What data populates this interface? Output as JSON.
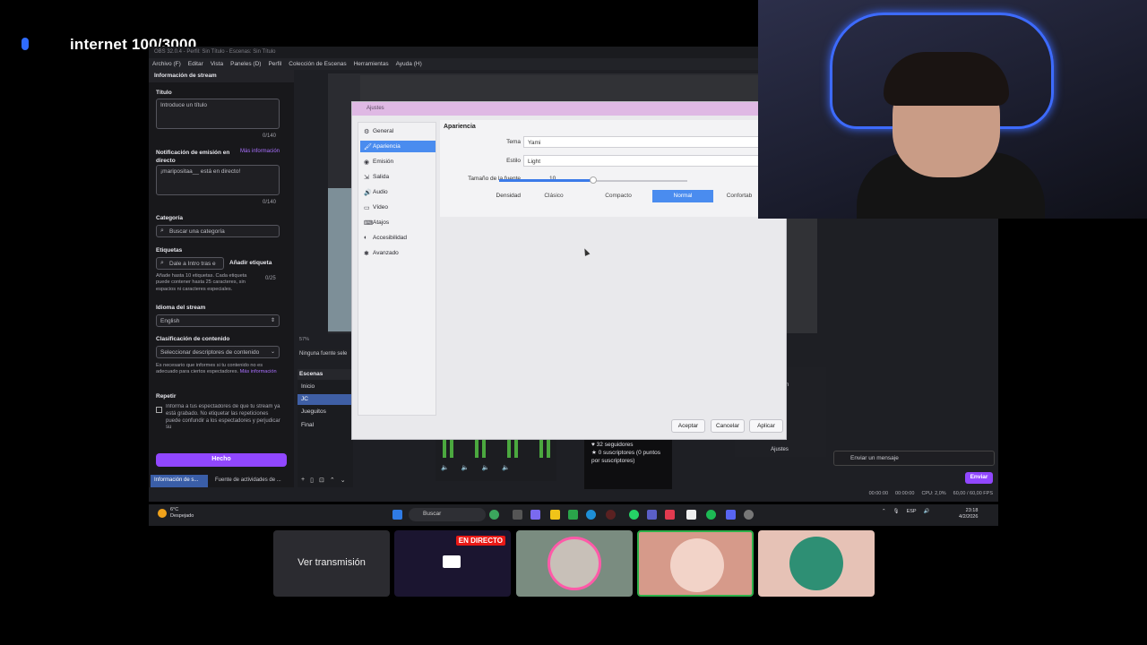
{
  "overlay": {
    "internet_text": "internet 100/3000"
  },
  "obs": {
    "title": "OBS 32.0.4 - Perfil: Sin Título - Escenas: Sin Título",
    "menu": [
      "Archivo (F)",
      "Editar",
      "Vista",
      "Paneles (D)",
      "Perfil",
      "Colección de Escenas",
      "Herramientas",
      "Ayuda (H)"
    ],
    "zoom": "57%",
    "no_source": "Ninguna fuente sele",
    "scenes_title": "Escenas",
    "scenes": [
      "Inicio",
      "JC",
      "Jueguitos",
      "Final"
    ],
    "controls": [
      "emisión",
      "ación",
      "rtual",
      "udio",
      "Ajustes"
    ]
  },
  "stream_info": {
    "panel_title": "Información de stream",
    "title_label": "Título",
    "title_placeholder": "Introduce un título",
    "title_count": "0/140",
    "notif_label": "Notificación de emisión en directo",
    "more_info": "Más información",
    "notif_value": "¡maripositaa__ está en directo!",
    "notif_count": "0/140",
    "category_label": "Categoría",
    "category_placeholder": "Buscar una categoría",
    "tags_label": "Etiquetas",
    "tags_placeholder": "Dale a Intro tras e",
    "add_tag": "Añadir etiqueta",
    "tags_count": "0/25",
    "tags_help": "Añade hasta 10 etiquetas. Cada etiqueta puede contener hasta 25 caracteres, sin espacios ni caracteres especiales.",
    "language_label": "Idioma del stream",
    "language_value": "English",
    "content_label": "Clasificación de contenido",
    "content_placeholder": "Seleccionar descriptores de contenido",
    "content_help": "Es necesario que informes si tu contenido no es adecuado para ciertos espectadores.",
    "content_more": "Más información",
    "repeat_label": "Repetir",
    "repeat_help": "Informa a tus espectadores de que tu stream ya está grabado. No etiquetar las repeticiones puede confundir a los espectadores y perjudicar su",
    "done_button": "Hecho",
    "tab1": "Información de s...",
    "tab2": "Fuente de actividades de ..."
  },
  "stats": {
    "followers": "32 seguidores",
    "subs": "0 suscriptores (0 puntos por suscriptores)"
  },
  "chat": {
    "placeholder": "Enviar un mensaje",
    "send": "Enviar"
  },
  "status": {
    "t1": "00:00:00",
    "t2": "00:00:00",
    "cpu": "CPU: 2,0%",
    "fps": "60,00 / 60,00 FPS"
  },
  "settings": {
    "title": "Ajustes",
    "nav": [
      {
        "label": "General",
        "icon": "⚙"
      },
      {
        "label": "Apariencia",
        "icon": "🖌"
      },
      {
        "label": "Emisión",
        "icon": "◉"
      },
      {
        "label": "Salida",
        "icon": "⇲"
      },
      {
        "label": "Audio",
        "icon": "🔊"
      },
      {
        "label": "Vídeo",
        "icon": "▭"
      },
      {
        "label": "Atajos",
        "icon": "⌨"
      },
      {
        "label": "Accesibilidad",
        "icon": "◐"
      },
      {
        "label": "Avanzado",
        "icon": "✱"
      }
    ],
    "section": "Apariencia",
    "theme_label": "Tema",
    "theme_value": "Yami",
    "style_label": "Estilo",
    "style_value": "Light",
    "font_label": "Tamaño de la fuente",
    "font_value": "10",
    "font_fraction": 0.5,
    "density_label": "Densidad",
    "density": [
      "Clásico",
      "Compacto",
      "Normal",
      "Confortab"
    ],
    "accept": "Aceptar",
    "cancel": "Cancelar",
    "apply": "Aplicar"
  },
  "taskbar": {
    "temp": "6°C",
    "weather": "Despejado",
    "search": "Buscar",
    "lang": "ESP",
    "time": "23:18",
    "date": "4/2/2026"
  },
  "bottom": {
    "view_stream": "Ver transmisión",
    "live_badge": "EN DIRECTO"
  }
}
